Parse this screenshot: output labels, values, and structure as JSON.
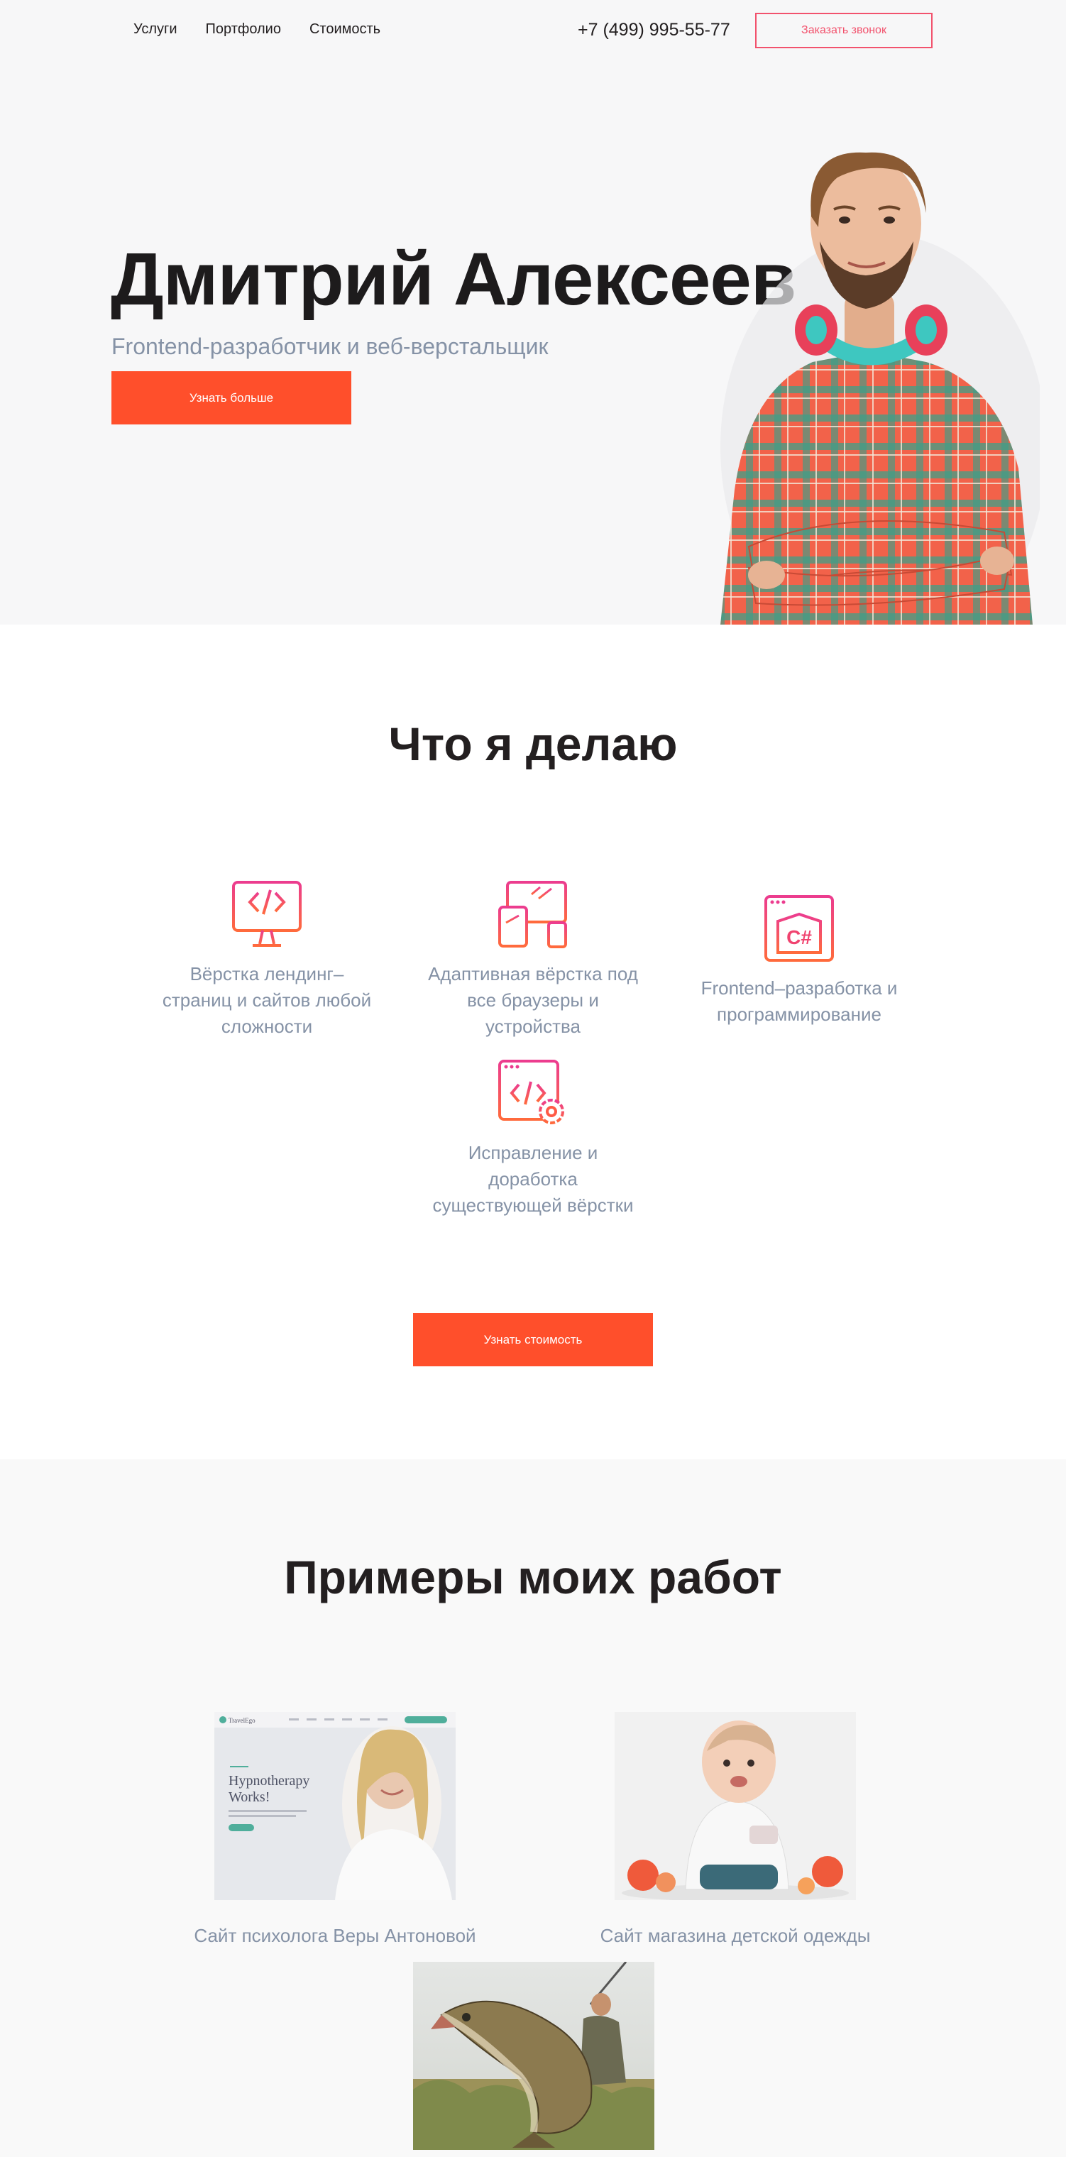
{
  "nav": {
    "links": [
      "Услуги",
      "Портфолио",
      "Стоимость"
    ],
    "phone": "+7 (499) 995-55-77",
    "call_button": "Заказать звонок"
  },
  "hero": {
    "title": "Дмитрий Алексеев",
    "subtitle": "Frontend-разработчик и веб-верстальщик",
    "button": "Узнать больше"
  },
  "services": {
    "title": "Что я делаю",
    "items": [
      {
        "label": "Вёрстка лендинг–страниц и сайтов любой сложности",
        "icon": "monitor-code-icon"
      },
      {
        "label": "Адаптивная вёрстка под все браузеры и устройства",
        "icon": "devices-icon"
      },
      {
        "label": "Frontend–разработка и программирование",
        "icon": "csharp-window-icon"
      },
      {
        "label": "Исправление и доработка существующей вёрстки",
        "icon": "code-gear-icon"
      }
    ],
    "button": "Узнать стоимость"
  },
  "portfolio": {
    "title": "Примеры моих работ",
    "works": [
      {
        "label": "Сайт психолога Веры Антоновой",
        "thumb_heading": "Hypnotherapy Works!",
        "thumb_logo": "TravelEgo"
      },
      {
        "label": "Сайт магазина детской одежды"
      },
      {
        "label": ""
      }
    ]
  },
  "colors": {
    "accent": "#ff4f2b",
    "pink": "#f2526d",
    "muted_text": "#8592a6",
    "dark_text": "#231f20",
    "hero_bg": "#f7f7f8",
    "portfolio_bg": "#f9f9f9"
  }
}
